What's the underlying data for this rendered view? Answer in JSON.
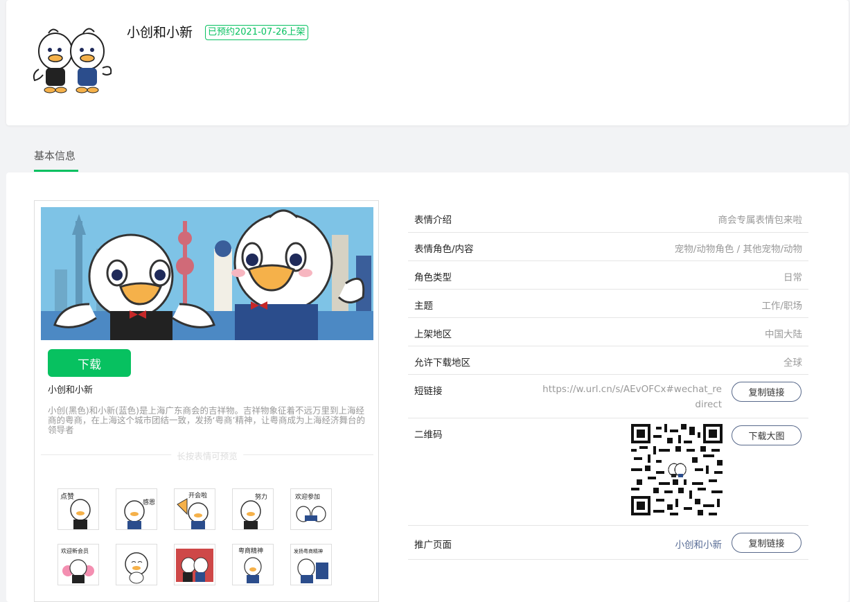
{
  "header": {
    "title": "小创和小新",
    "status_badge": "已预约2021-07-26上架"
  },
  "tabs": [
    {
      "label": "基本信息",
      "active": true
    }
  ],
  "preview": {
    "download_label": "下载",
    "name": "小创和小新",
    "description": "小创(黑色)和小新(蓝色)是上海广东商会的吉祥物。吉祥物象征着不远万里到上海经商的粤商，在上海这个城市团结一致，发扬‘粤商’精神，让粤商成为上海经济舞台的领导者",
    "hint": "长按表情可预览",
    "stickers": [
      {
        "caption": "点赞"
      },
      {
        "caption": "感恩"
      },
      {
        "caption": "开会啦"
      },
      {
        "caption": "努力"
      },
      {
        "caption": "欢迎参加"
      },
      {
        "caption": "欢迎新会员"
      },
      {
        "caption": ""
      },
      {
        "caption": ""
      },
      {
        "caption": "粤商精神"
      },
      {
        "caption": "发扬粤商精神"
      }
    ]
  },
  "info": {
    "intro_label": "表情介绍",
    "intro_value": "商会专属表情包来啦",
    "role_label": "表情角色/内容",
    "role_value": "宠物/动物角色 / 其他宠物/动物",
    "type_label": "角色类型",
    "type_value": "日常",
    "theme_label": "主题",
    "theme_value": "工作/职场",
    "region_label": "上架地区",
    "region_value": "中国大陆",
    "download_region_label": "允许下载地区",
    "download_region_value": "全球",
    "shortlink_label": "短链接",
    "shortlink_value": "https://w.url.cn/s/AEvOFCx#wechat_redirect",
    "copy_link_label": "复制链接",
    "qr_label": "二维码",
    "qr_button_label": "下载大图",
    "promo_label": "推广页面",
    "promo_value": "小创和小新",
    "promo_button_label": "复制链接"
  },
  "colors": {
    "accent": "#07c160",
    "link": "#576b95",
    "muted": "#999999"
  }
}
